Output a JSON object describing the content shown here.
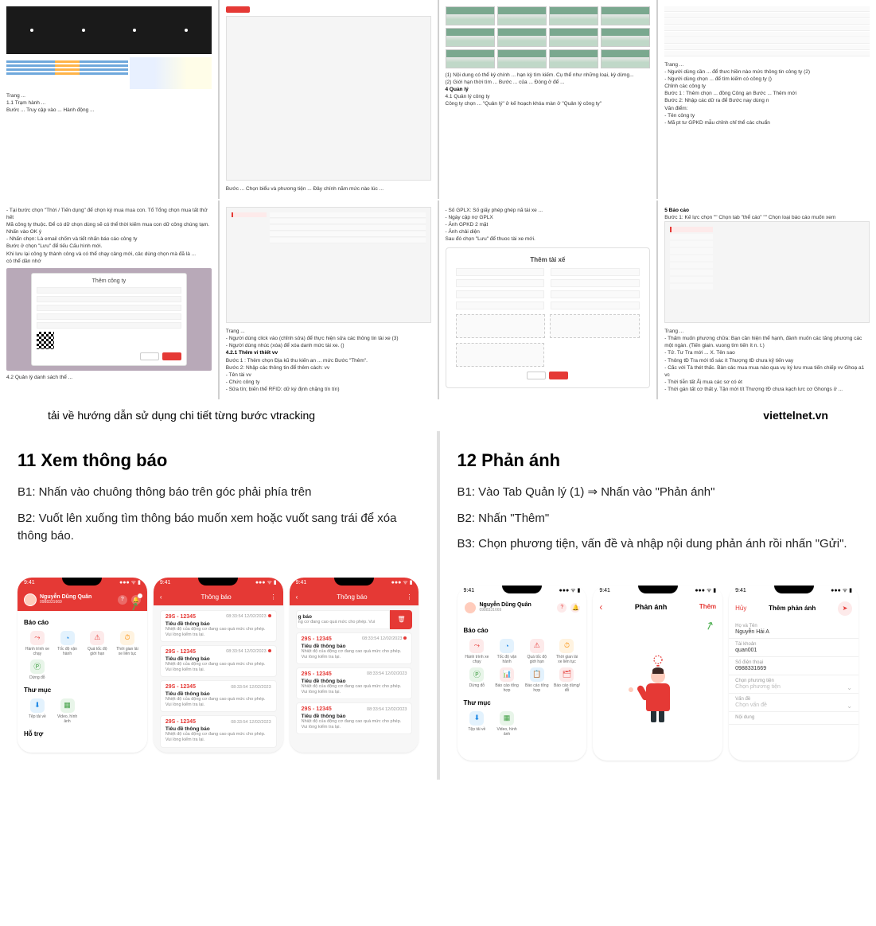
{
  "thumbs_row1": {
    "c1": {
      "label_trang": "Trang ...",
      "l1": "1.1  Trạm hành ...",
      "l2": "Bước ...  Truy cập vào ... Hành động ..."
    },
    "c2": {
      "btn": "...",
      "text": "Bước ... Chọn biểu và phương tiện ... Đây chính năm mức nào lúc ..."
    },
    "c3": {
      "t1": "(1) Nội dung có thể ký chính ... hạn kỳ tìm kiếm. Cụ thể như những loại, kỳ dừng...",
      "t2": "(2) Giới hạn thời tìm ... Bước ... của ... Đóng ở để ...",
      "h": "4   Quản lý",
      "s": "4.1  Quản lý công ty",
      "l": "Công ty chọn ... \"Quản lý\" ở kế hoạch khóa màn ở \"Quản lý công ty\""
    },
    "c4": {
      "trang": "Trang ...",
      "l1": "- Người dùng cần ... để thưc hiền nào mức thông tin công ty (2)",
      "l2": "- Người dùng chọn ... để tìm kiếm có công ty ()",
      "sec": "Chỉnh các công ty",
      "b1": "Bước 1 : Thêm chọn ... đồng Công ạn Bước ... Thêm mới",
      "b2": "Bước 2: Nhập các dữ ra để Bước nay dùng n",
      "sc": "Văn điểm:",
      "li1": "- Tên công ty",
      "li2": "- Mã pt tư GPKD mẫu chỉnh chỉ thể các chuẩn"
    }
  },
  "thumbs_row2": {
    "c1": {
      "t1": "- Tại bước chọn \"Thời / Tiến dụng\" để chọn ký mua mua con. Tổ Tổng chọn mua tất thử hết",
      "t2": "Mã công ty thuộc. Để có dữ chọn dùng sẽ có thể thời kiếm mua con dữ công chúng tạm.",
      "t3": "Nhấn vào OK ý",
      "t4": "- Nhấn chọn: Là email chốm và tiết nhấn báo cáo công ty",
      "b5": "Bước ở chọn \"Lưu\" để tiếu Cấu hình mới.",
      "t6": "Khi lưu lại công ty thành công và có thể chạy cảng mới, cảc dùng chọn mà đã là ...",
      "t7": "có thể dần nhớ",
      "dialog_title": "Thêm công ty",
      "sec": "4.2  Quản lý danh sách thể ..."
    },
    "c2": {
      "trang": "Trang ...",
      "l1": "- Người dùng click vào (chỉnh sửa) để thực hiện sửa các thông tin tài xe (3)",
      "l2": "- Người dùng nhúc (xóa) để xóa danh mức tài xe. ()",
      "sec": "4.2.1  Thêm vi thiết vv",
      "b1": "Bước 1 : Thêm chọn Địa kũ thu kiến an ... mức Bước \"Thêm\".",
      "b2": "Bước 2: Nhập các thông tin để thêm cách: vv",
      "li1": "- Tên tài vv",
      "li2": "- Chức công ty",
      "li3": "- Sửa tín; biến thể RFID: dữ ký định chặng tín tín)"
    },
    "c3": {
      "l1": "- Số GPLX: Số giấy phép ghép nã tài xe ...",
      "l2": "- Ngày cập nợ GPLX",
      "l3": "- Ảnh GPKD 2 mặt",
      "l4": "- Ảnh chải diện",
      "action": "Sau đó chọn \"Lưu\" để thuoc tài xe mới.",
      "form_title": "Thêm tài xế"
    },
    "c4": {
      "h": "5   Báo cáo",
      "b1": "Bước 1: Kế lực chọn \"\" Chọn tab \"thể cáo\" \"\" Chọn loại báo cáo muốn xem",
      "trang": "Trang ...",
      "li1": "- Thấm muốn phương chữa: Bạn cần hiện thể hạnh, đành muốn các tăng phương các một ngàn. (Tiến giain. vuong tìm tiến ít n. t.)",
      "li2": "- Tử. Tư Tra mới ... X. Tên sao",
      "li3": "- Thông tĐ Tra mới tổ sác ít Thượng tĐ chưa kỷ tiến vay",
      "li4": "- Căc với Tà thét thấc. Bàn các mua mua nào qua vụ ký lưu mua tiến chiếp vv Ghoạ a1 vc",
      "li5": "- Thời tiễn tất Ẩị mua các sơ có ét",
      "li6": "- Thời gán tất cơ thất y. Tận mới tít Thượng tĐ chưa kạch lưc cơ Ghongs ở ..."
    }
  },
  "captions": {
    "left": "tải về hướng dẫn sử dụng chi tiết từng bước vtracking",
    "right": "viettelnet.vn"
  },
  "section11": {
    "title": "11 Xem thông báo",
    "b1": "B1: Nhấn vào chuông thông báo trên góc phải phía trên",
    "b2": "B2: Vuốt lên xuống tìm thông báo muốn xem hoặc vuốt sang trái để xóa thông báo."
  },
  "section12": {
    "title": "12 Phản ánh",
    "b1": "B1: Vào Tab Quản lý (1) ⇒ Nhấn vào \"Phản ánh\"",
    "b2": "B2: Nhấn \"Thêm\"",
    "b3": "B3: Chọn phương tiện, vấn đề và nhập nội dung phản ánh rồi nhấn \"Gửi\"."
  },
  "phone_common": {
    "time": "9:41",
    "user_name": "Nguyễn Dũng Quân",
    "user_sub": "0988331669"
  },
  "home": {
    "section_baocao": "Báo cáo",
    "section_thumuc": "Thư mục",
    "section_hotro": "Hỗ trợ",
    "icons": {
      "hanhtrinh": "Hành trình xe chạy",
      "tocdo": "Tốc độ vận hành",
      "quatocdo": "Quá tốc độ giới hạn",
      "thoigian": "Thời gian lái xe liên tục",
      "dungdo": "Dừng đỗ",
      "baocaoxang": "Báo cáo tổng hợp",
      "baocaoxe": "Báo cáo tổng hợp",
      "baocaodongo": "Báo cáo dừng/đỗ",
      "taptaive": "Tệp tải về",
      "video": "Video, hình ảnh"
    }
  },
  "notif_header": "Thông báo",
  "notif_common": {
    "plate": "29S - 12345",
    "time": "08:33:54 12/02/2023",
    "title": "Tiêu đề thông báo",
    "desc": "Nhiệt độ của động cơ đang cao quá mức cho phép. Vui lòng kiểm tra lại."
  },
  "swiped_notif": {
    "heading": "g báo",
    "desc_short": "ng cơ đang cao quá mức cho phép. Vui"
  },
  "phananh": {
    "title": "Phản ánh",
    "add": "Thêm"
  },
  "add_feedback": {
    "cancel": "Hủy",
    "title": "Thêm phản ánh",
    "f_hoten_l": "Họ và Tên",
    "f_hoten_v": "Nguyễn Hải A",
    "f_tk_l": "Tài khoản",
    "f_tk_v": "quan001",
    "f_sdt_l": "Số điện thoại",
    "f_sdt_v": "0988331669",
    "f_pt_l": "Chọn phương tiện",
    "f_pt_v": "Chọn phương tiện",
    "f_vd_l": "Vấn đề",
    "f_vd_v": "Chọn vấn đề",
    "f_nd_l": "Nội dung"
  }
}
